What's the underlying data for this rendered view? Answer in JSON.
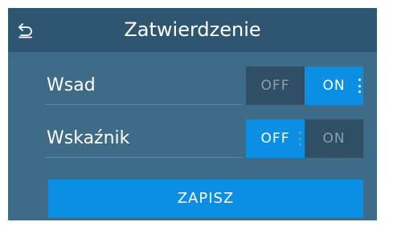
{
  "header": {
    "back_icon": "back-arrow-icon",
    "title": "Zatwierdzenie"
  },
  "settings": [
    {
      "label": "Wsad",
      "off_label": "OFF",
      "on_label": "ON",
      "value": "ON"
    },
    {
      "label": "Wskaźnik",
      "off_label": "OFF",
      "on_label": "ON",
      "value": "OFF"
    }
  ],
  "actions": {
    "save_label": "ZAPISZ"
  },
  "colors": {
    "panel": "#3d6b88",
    "header": "#2f5670",
    "accent": "#0a8fe4",
    "toggle_off": "#2e4f64"
  }
}
